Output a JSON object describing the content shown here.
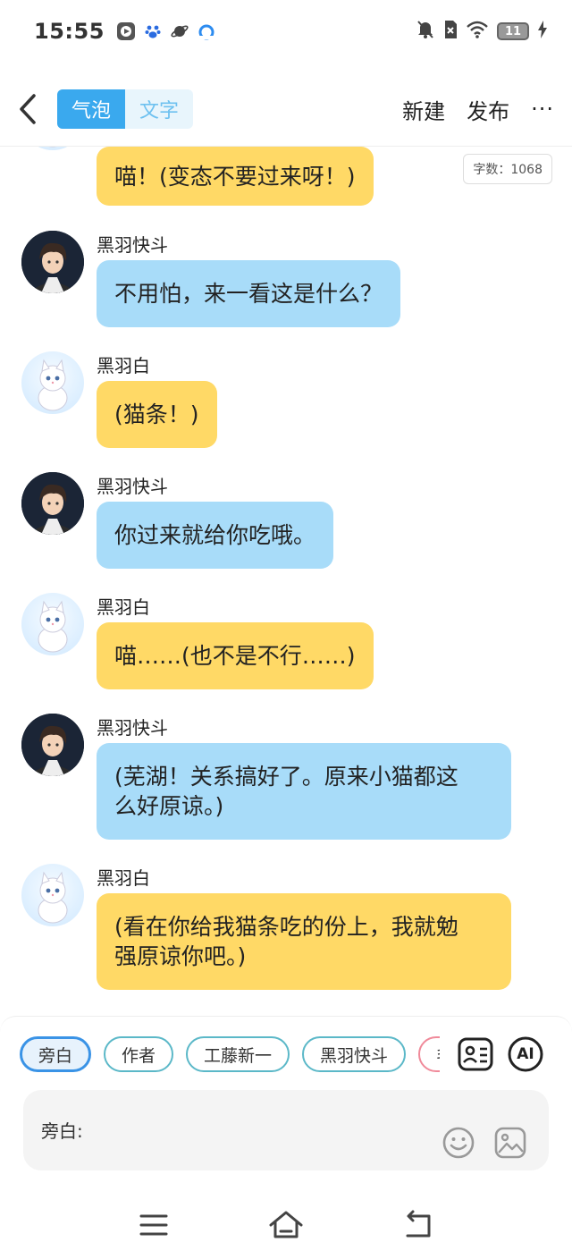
{
  "status_bar": {
    "time": "15:55",
    "battery": "11",
    "icons": [
      "video-app-icon",
      "baidu-paw-icon",
      "planet-app-icon",
      "browser-app-icon",
      "mute-icon",
      "sim-off-icon",
      "wifi-icon",
      "battery-icon",
      "charging-bolt-icon"
    ]
  },
  "header": {
    "tabs": [
      {
        "label": "气泡",
        "active": true
      },
      {
        "label": "文字",
        "active": false
      }
    ],
    "new_label": "新建",
    "publish_label": "发布",
    "more_label": "···"
  },
  "word_count": "字数：1068",
  "messages": [
    {
      "speaker": "",
      "avatar": "white-cat-avatar",
      "text": "喵！(变态不要过来呀！)",
      "color": "yellow"
    },
    {
      "speaker": "黑羽快斗",
      "avatar": "kaito-avatar",
      "text": "不用怕，来一看这是什么？",
      "color": "blue"
    },
    {
      "speaker": "黑羽白",
      "avatar": "white-cat-avatar",
      "text": "(猫条！)",
      "color": "yellow"
    },
    {
      "speaker": "黑羽快斗",
      "avatar": "kaito-avatar",
      "text": "你过来就给你吃哦。",
      "color": "blue"
    },
    {
      "speaker": "黑羽白",
      "avatar": "white-cat-avatar",
      "text": "喵……(也不是不行……)",
      "color": "yellow"
    },
    {
      "speaker": "黑羽快斗",
      "avatar": "kaito-avatar",
      "text_lines": [
        "(芜湖！关系搞好了。原来小猫都这",
        "么好原谅。)"
      ],
      "color": "blue"
    },
    {
      "speaker": "黑羽白",
      "avatar": "white-cat-avatar",
      "text_lines": [
        "(看在你给我猫条吃的份上，我就勉",
        "强原谅你吧。)"
      ],
      "color": "yellow"
    }
  ],
  "role_chips": [
    {
      "label": "旁白",
      "active": true
    },
    {
      "label": "作者",
      "active": false
    },
    {
      "label": "工藤新一",
      "active": false
    },
    {
      "label": "黑羽快斗",
      "active": false
    },
    {
      "label": "毛",
      "active": false
    }
  ],
  "tools": {
    "ai_label": "AI"
  },
  "input": {
    "label": "旁白:"
  },
  "colors": {
    "accent": "#3aa9ee",
    "bubble_yellow": "#ffd966",
    "bubble_blue": "#a8dcf9"
  }
}
